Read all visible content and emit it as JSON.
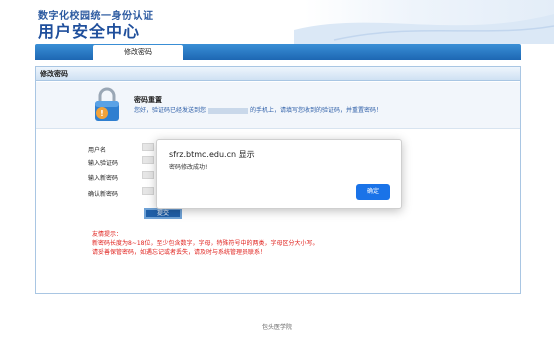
{
  "header": {
    "subtitle": "数字化校园统一身份认证",
    "title": "用户安全中心"
  },
  "nav": {
    "tab_label": "修改密码"
  },
  "panel": {
    "title": "修改密码",
    "banner_title": "密码重置",
    "banner_text_before": "您好，验证码已经发送到您",
    "banner_text_after": "的手机上，请填写您收到的验证码，并重置密码！"
  },
  "form": {
    "username_label": "用户名",
    "code_label": "输入验证码",
    "new_password_label": "输入新密码",
    "confirm_password_label": "确认新密码",
    "submit_label": "提交"
  },
  "tips": {
    "title": "友情提示：",
    "line1": "新密码长度为8~18位，至少包含数字，字母，特殊符号中的两类，字母区分大小写。",
    "line2": "请妥善保管密码，如遇忘记或者丢失，请及时与系统管理员联系！"
  },
  "footer": {
    "text": "包头医学院"
  },
  "dialog": {
    "title": "sfrz.btmc.edu.cn 显示",
    "message": "密码修改成功!",
    "ok_label": "确定"
  },
  "colors": {
    "brand_blue": "#1f4f9c",
    "nav_blue": "#1d67b3",
    "tip_red": "#e0201c",
    "dialog_button": "#1a73e8"
  }
}
